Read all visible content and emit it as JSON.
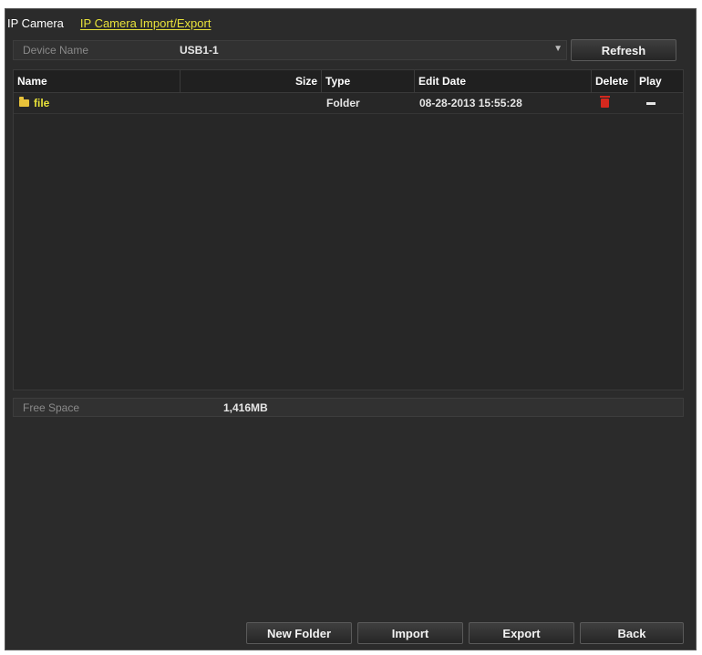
{
  "tabs": [
    {
      "label": "IP Camera",
      "active": false
    },
    {
      "label": "IP Camera Import/Export",
      "active": true
    }
  ],
  "device": {
    "label": "Device Name",
    "value": "USB1-1",
    "refresh_label": "Refresh"
  },
  "table": {
    "columns": [
      "Name",
      "Size",
      "Type",
      "Edit Date",
      "Delete",
      "Play"
    ],
    "rows": [
      {
        "name": "file",
        "size": "",
        "type": "Folder",
        "edit_date": "08-28-2013 15:55:28",
        "icon": "folder-icon"
      }
    ]
  },
  "free_space": {
    "label": "Free Space",
    "value": "1,416MB"
  },
  "buttons": {
    "new_folder": "New Folder",
    "import": "Import",
    "export": "Export",
    "back": "Back"
  },
  "colors": {
    "accent": "#e8e23a",
    "background": "#2b2b2b",
    "delete": "#d4281e"
  }
}
